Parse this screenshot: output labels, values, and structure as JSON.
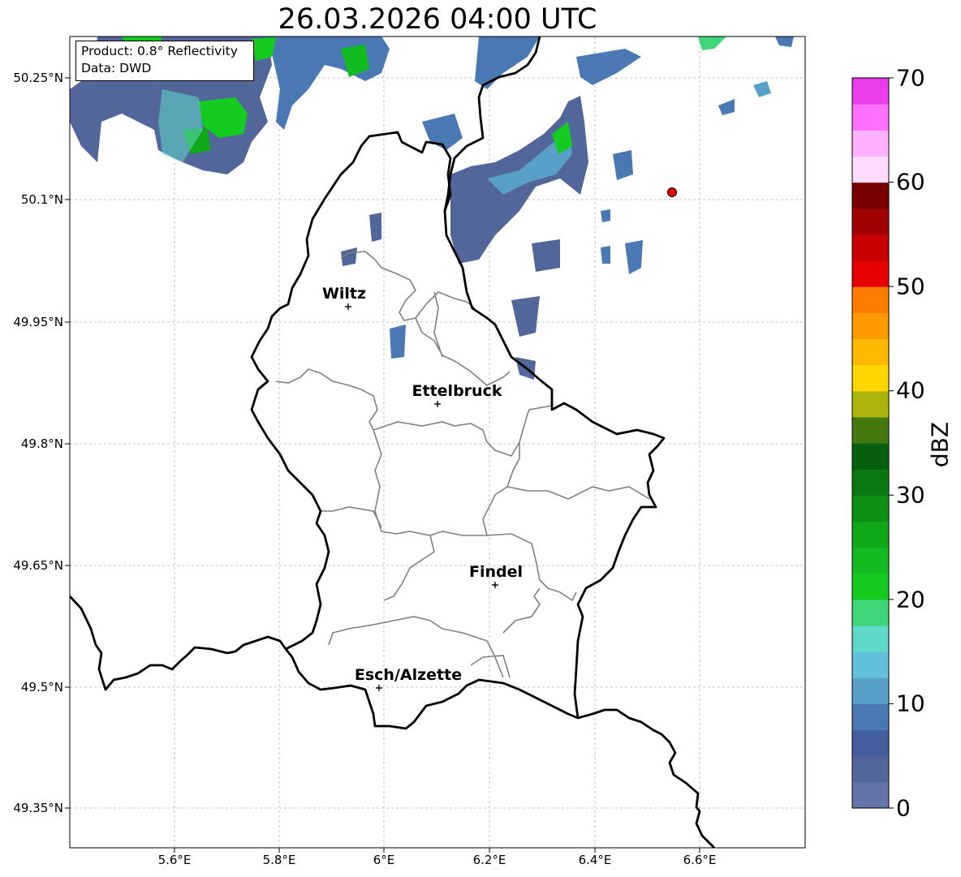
{
  "title": "26.03.2026 04:00 UTC",
  "info": {
    "product": "Product: 0.8° Reflectivity",
    "source": "Data: DWD"
  },
  "axes": {
    "lat_ticks": [
      "50.25°N",
      "50.1°N",
      "49.95°N",
      "49.8°N",
      "49.65°N",
      "49.5°N",
      "49.35°N"
    ],
    "lon_ticks": [
      "5.6°E",
      "5.8°E",
      "6°E",
      "6.2°E",
      "6.4°E",
      "6.6°E"
    ]
  },
  "colorbar": {
    "label": "dBZ",
    "ticks": [
      "0",
      "10",
      "20",
      "30",
      "40",
      "50",
      "60",
      "70"
    ],
    "colors": [
      "#6374a8",
      "#52669a",
      "#445ea0",
      "#4a78b2",
      "#58a0c8",
      "#62c0dc",
      "#60d8c8",
      "#3ed678",
      "#14cc20",
      "#12bc20",
      "#10a818",
      "#0e9014",
      "#0a7812",
      "#06600e",
      "#467810",
      "#aab40a",
      "#ffd600",
      "#ffb800",
      "#ff9a00",
      "#ff7c00",
      "#e60000",
      "#c80000",
      "#a00000",
      "#780000",
      "#ffdcff",
      "#ffb0ff",
      "#ff70ff",
      "#ea3cea"
    ]
  },
  "cities": [
    {
      "name": "Wiltz"
    },
    {
      "name": "Ettelbruck"
    },
    {
      "name": "Findel"
    },
    {
      "name": "Esch/Alzette"
    }
  ],
  "marker": {
    "color": "#e60000"
  },
  "colors": {
    "country_border": "#000000",
    "canton_border": "#808080",
    "grid": "#b0b0b0"
  }
}
